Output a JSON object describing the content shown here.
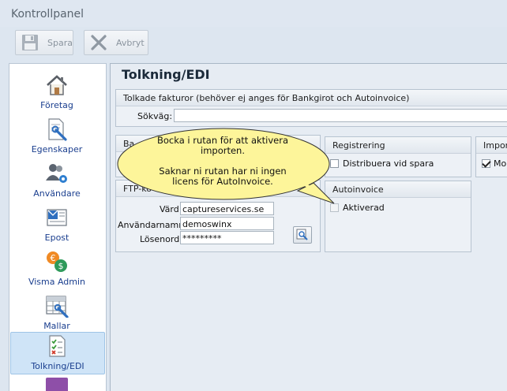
{
  "window": {
    "title": "Kontrollpanel"
  },
  "toolbar": {
    "save_label": "Spara",
    "cancel_label": "Avbryt"
  },
  "sidebar": {
    "items": [
      {
        "label": "Företag",
        "icon": "home-icon",
        "selected": false
      },
      {
        "label": "Egenskaper",
        "icon": "document-wrench-icon",
        "selected": false
      },
      {
        "label": "Användare",
        "icon": "users-gear-icon",
        "selected": false
      },
      {
        "label": "Epost",
        "icon": "mail-icon",
        "selected": false
      },
      {
        "label": "Visma Admin",
        "icon": "currency-coins-icon",
        "selected": false
      },
      {
        "label": "Mallar",
        "icon": "grid-wrench-icon",
        "selected": false
      },
      {
        "label": "Tolkning/EDI",
        "icon": "checklist-icon",
        "selected": true
      }
    ]
  },
  "main": {
    "title": "Tolkning/EDI",
    "parsed_invoices": {
      "header": "Tolkade fakturor (behöver ej anges för Bankgirot och Autoinvoice)",
      "path_label": "Sökväg:",
      "path_value": ""
    },
    "bankgiro_group": {
      "header": "Ba"
    },
    "ftp_group": {
      "header": "FTP-ko",
      "host_label": "Värd:",
      "host_value": "captureservices.se",
      "user_label": "Användarnamn:",
      "user_value": "demoswinx",
      "password_label": "Lösenord:",
      "password_value": "*********"
    },
    "registration_group": {
      "header": "Registrering",
      "distribute_label": "Distribuera vid spara",
      "distribute_checked": false
    },
    "autoinvoice_group": {
      "header": "Autoinvoice",
      "activated_label": "Aktiverad",
      "activated_checked": false
    },
    "import_group": {
      "header": "Impor",
      "item_label": "Mon",
      "item_checked": true
    }
  },
  "callout": {
    "line1": "Bocka i rutan för att aktivera importen.",
    "line2": "Saknar ni rutan har ni ingen licens för AutoInvoice."
  },
  "colors": {
    "sidebar_label": "#1b3f8f",
    "selected_item": "#cfe4f7",
    "callout_fill": "#fdf59a"
  }
}
